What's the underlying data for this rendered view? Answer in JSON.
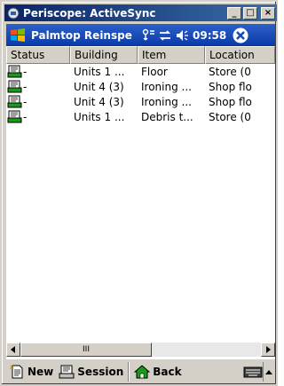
{
  "window": {
    "title": "Periscope: ActiveSync",
    "minimize": "_",
    "maximize": "□",
    "close": "×"
  },
  "navbar": {
    "title": "Palmtop Reinspe",
    "time": "09:58",
    "icons": [
      "start-icon",
      "connection-icon",
      "sync-icon",
      "volume-icon",
      "close-icon"
    ]
  },
  "list": {
    "columns": [
      "Status",
      "Building",
      "Item",
      "Location"
    ],
    "rows": [
      {
        "status": "-",
        "building": "Units 1 ...",
        "item": "Floor",
        "location": "Store (0"
      },
      {
        "status": "-",
        "building": "Unit 4 (3)",
        "item": "Ironing ...",
        "location": "Shop flo"
      },
      {
        "status": "-",
        "building": "Unit 4 (3)",
        "item": "Ironing ...",
        "location": "Shop flo"
      },
      {
        "status": "-",
        "building": "Units 1 ...",
        "item": "Debris t...",
        "location": "Store (0"
      }
    ]
  },
  "scrollbar": {
    "thumb_grip": "III"
  },
  "commandbar": {
    "new_label": "New",
    "session_label": "Session",
    "back_label": "Back"
  },
  "colors": {
    "titlebar": "#0a246a",
    "navbar": "#1648b8",
    "chrome": "#d4d0c8",
    "status_icon": "#1a9a1a"
  }
}
